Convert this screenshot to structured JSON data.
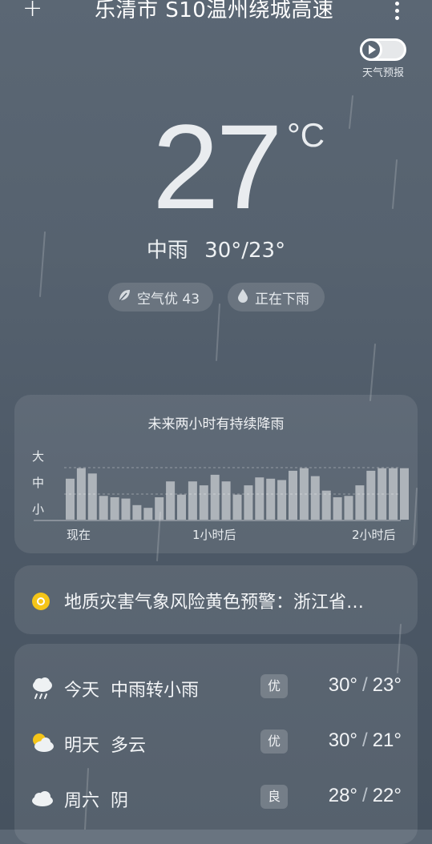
{
  "header": {
    "add_label": "+",
    "city": "乐清市 S10温州绕城高速",
    "forecast_video_label": "天气预报"
  },
  "current": {
    "temperature": "27",
    "unit": "°C",
    "condition": "中雨",
    "high_low": "30°/23°",
    "air_quality": "空气优 43",
    "precip_status": "正在下雨"
  },
  "rain_chart": {
    "title": "未来两小时有持续降雨",
    "y_labels": [
      "大",
      "中",
      "小"
    ],
    "x_labels": [
      "现在",
      "1小时后",
      "2小时后"
    ]
  },
  "chart_data": {
    "type": "bar",
    "title": "未来两小时有持续降雨",
    "y_categories": [
      "小",
      "中",
      "大"
    ],
    "ylim": [
      0,
      3
    ],
    "values": [
      1.55,
      1.95,
      1.75,
      0.9,
      0.85,
      0.8,
      0.55,
      0.45,
      0.85,
      1.45,
      0.95,
      1.45,
      1.3,
      1.7,
      1.45,
      0.95,
      1.3,
      1.6,
      1.55,
      1.5,
      1.85,
      1.95,
      1.65,
      1.1,
      0.85,
      0.9,
      1.3,
      1.85,
      1.95,
      1.95,
      1.95
    ],
    "x_tick_labels": [
      "现在",
      "1小时后",
      "2小时后"
    ]
  },
  "warning": {
    "text": "地质灾害气象风险黄色预警：浙江省…",
    "color": "#f5c518"
  },
  "forecast": [
    {
      "day": "今天",
      "desc": "中雨转小雨",
      "aqi": "优",
      "high": "30°",
      "low": "23°",
      "icon": "rain-cloud-icon"
    },
    {
      "day": "明天",
      "desc": "多云",
      "aqi": "优",
      "high": "30°",
      "low": "21°",
      "icon": "partly-cloudy-icon"
    },
    {
      "day": "周六",
      "desc": "阴",
      "aqi": "良",
      "high": "28°",
      "low": "22°",
      "icon": "cloud-icon"
    }
  ],
  "forecast_sep": "/"
}
